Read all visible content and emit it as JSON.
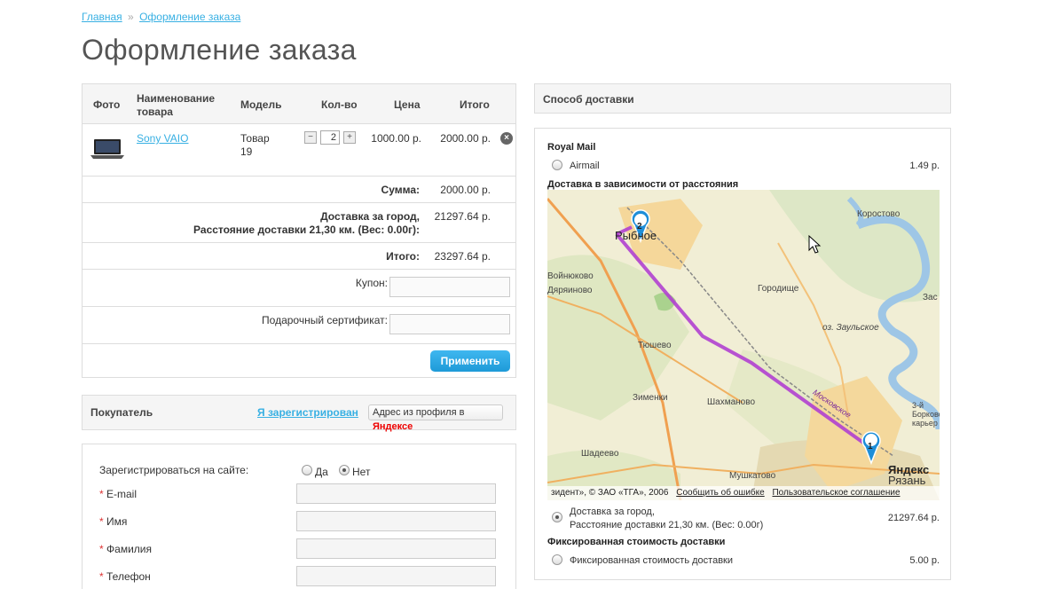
{
  "breadcrumb": {
    "home": "Главная",
    "separator": "»",
    "current": "Оформление заказа"
  },
  "page_title": "Оформление заказа",
  "cart": {
    "headers": {
      "photo": "Фото",
      "name_l1": "Наименование",
      "name_l2": "товара",
      "model": "Модель",
      "qty": "Кол-во",
      "price": "Цена",
      "total": "Итого"
    },
    "item": {
      "name": "Sony VAIO",
      "model_l1": "Товар",
      "model_l2": "19",
      "qty": "2",
      "price": "1000.00 р.",
      "total": "2000.00 р.",
      "minus": "−",
      "plus": "+",
      "remove": "×"
    },
    "sum_label": "Сумма:",
    "sum_value": "2000.00 р.",
    "delivery_label_l1": "Доставка за город,",
    "delivery_label_l2": "Расстояние доставки 21,30 км. (Вес: 0.00г):",
    "delivery_value": "21297.64 р.",
    "total_label": "Итого:",
    "total_value": "23297.64 р.",
    "coupon_label": "Купон:",
    "certificate_label": "Подарочный сертификат:",
    "apply_button": "Применить"
  },
  "buyer": {
    "title": "Покупатель",
    "registered_link": "Я зарегистрирован",
    "yandex_button_text": "Адрес из профиля в",
    "yandex_logo": "Яндексе",
    "register_label": "Зарегистрироваться на сайте:",
    "yes": "Да",
    "no": "Нет",
    "required_mark": "*",
    "email_label": "E-mail",
    "name_label": "Имя",
    "surname_label": "Фамилия",
    "phone_label": "Телефон"
  },
  "shipping": {
    "title": "Способ доставки",
    "royal_mail": "Royal Mail",
    "airmail": "Airmail",
    "airmail_price": "1.49 р.",
    "distance_title": "Доставка в зависимости от расстояния",
    "distance_option_l1": "Доставка за город,",
    "distance_option_l2": "Расстояние доставки 21,30 км. (Вес: 0.00г)",
    "distance_price": "21297.64 р.",
    "fixed_title": "Фиксированная стоимость доставки",
    "fixed_option": "Фиксированная стоимость доставки",
    "fixed_price": "5.00 р."
  },
  "map": {
    "places": [
      "Рыбное",
      "Коростово",
      "Войнюково",
      "Дяряиново",
      "Городище",
      "Зас",
      "оз. Заульское",
      "Тюшево",
      "Зименки",
      "Шахманово",
      "Мушкатово",
      "Шадеево",
      "3-й Борковский карьер",
      "Московское"
    ],
    "marker_1": "1",
    "marker_2": "2",
    "copyright": "зидент», © ЗАО «ТГА», 2006",
    "report_error": "Сообщить об ошибке",
    "agreement": "Пользовательское соглашение",
    "logo": "Яндекс",
    "city": "Рязань",
    "colors": {
      "route": "#b040d0",
      "marker": "#1e8ed8"
    }
  }
}
